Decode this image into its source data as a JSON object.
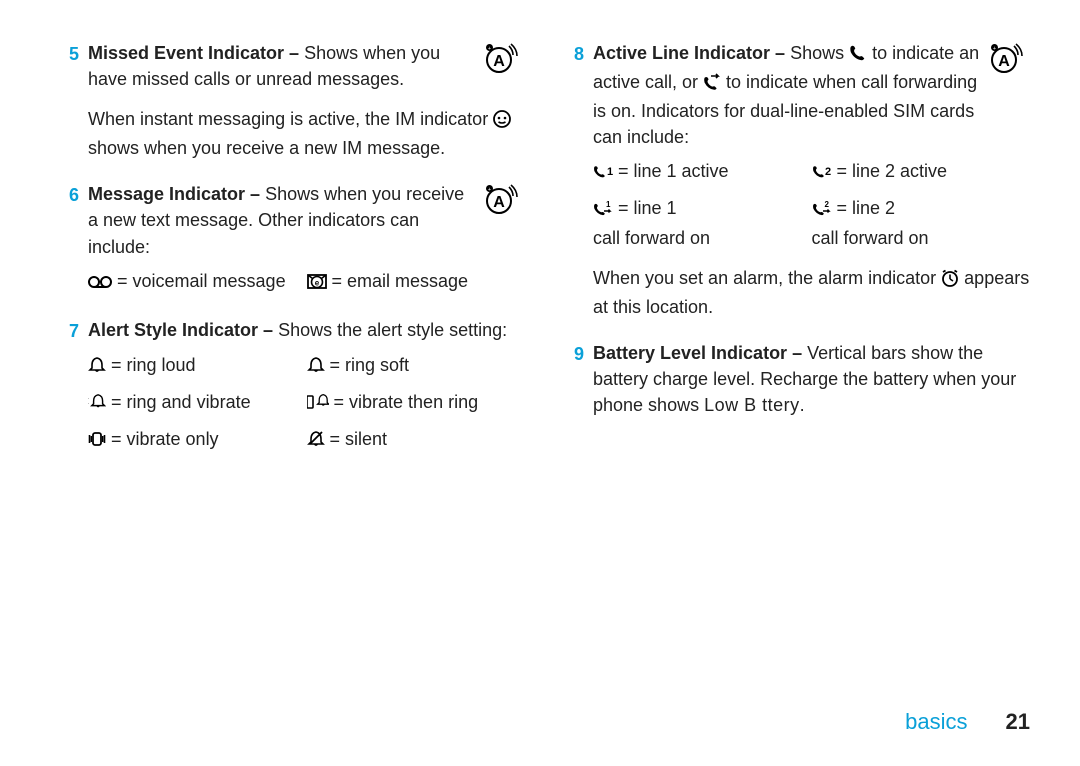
{
  "left": {
    "item5": {
      "num": "5",
      "title": "Missed Event Indicator –",
      "lead": " Shows when you have missed calls or unread messages.",
      "para2a": "When instant messaging is active, the IM indicator ",
      "para2b": " shows when you receive a new IM message."
    },
    "item6": {
      "num": "6",
      "title": "Message Indicator –",
      "lead": " Shows when you receive a new text message. Other indicators can include:",
      "cells": {
        "a": " = voicemail message",
        "b": " = email message"
      }
    },
    "item7": {
      "num": "7",
      "title": "Alert Style Indicator –",
      "lead": " Shows the alert style setting:",
      "cells": {
        "a": " = ring loud",
        "b": " = ring soft",
        "c": " = ring and vibrate",
        "d": " = vibrate then ring",
        "e": " = vibrate only",
        "f": " = silent"
      }
    }
  },
  "right": {
    "item8": {
      "num": "8",
      "title": "Active Line Indicator –",
      "lead_a": " Shows ",
      "lead_b": " to indicate an active call, or ",
      "lead_c": " to indicate when call forwarding is on. Indicators for dual-line-enabled SIM cards can include:",
      "cells": {
        "a": " = line 1 active",
        "b": " = line 2 active",
        "c_top": " = line 1",
        "c_bot": "call forward on",
        "d_top": " = line 2",
        "d_bot": "call forward on"
      },
      "para2a": "When you set an alarm, the alarm indicator ",
      "para2b": " appears at this location."
    },
    "item9": {
      "num": "9",
      "title": "Battery Level Indicator –",
      "lead": " Vertical bars show the battery charge level. Recharge the battery when your phone shows ",
      "lowbat": "Low B  ttery",
      "tail": "."
    }
  },
  "footer": {
    "section": "basics",
    "page": "21"
  }
}
